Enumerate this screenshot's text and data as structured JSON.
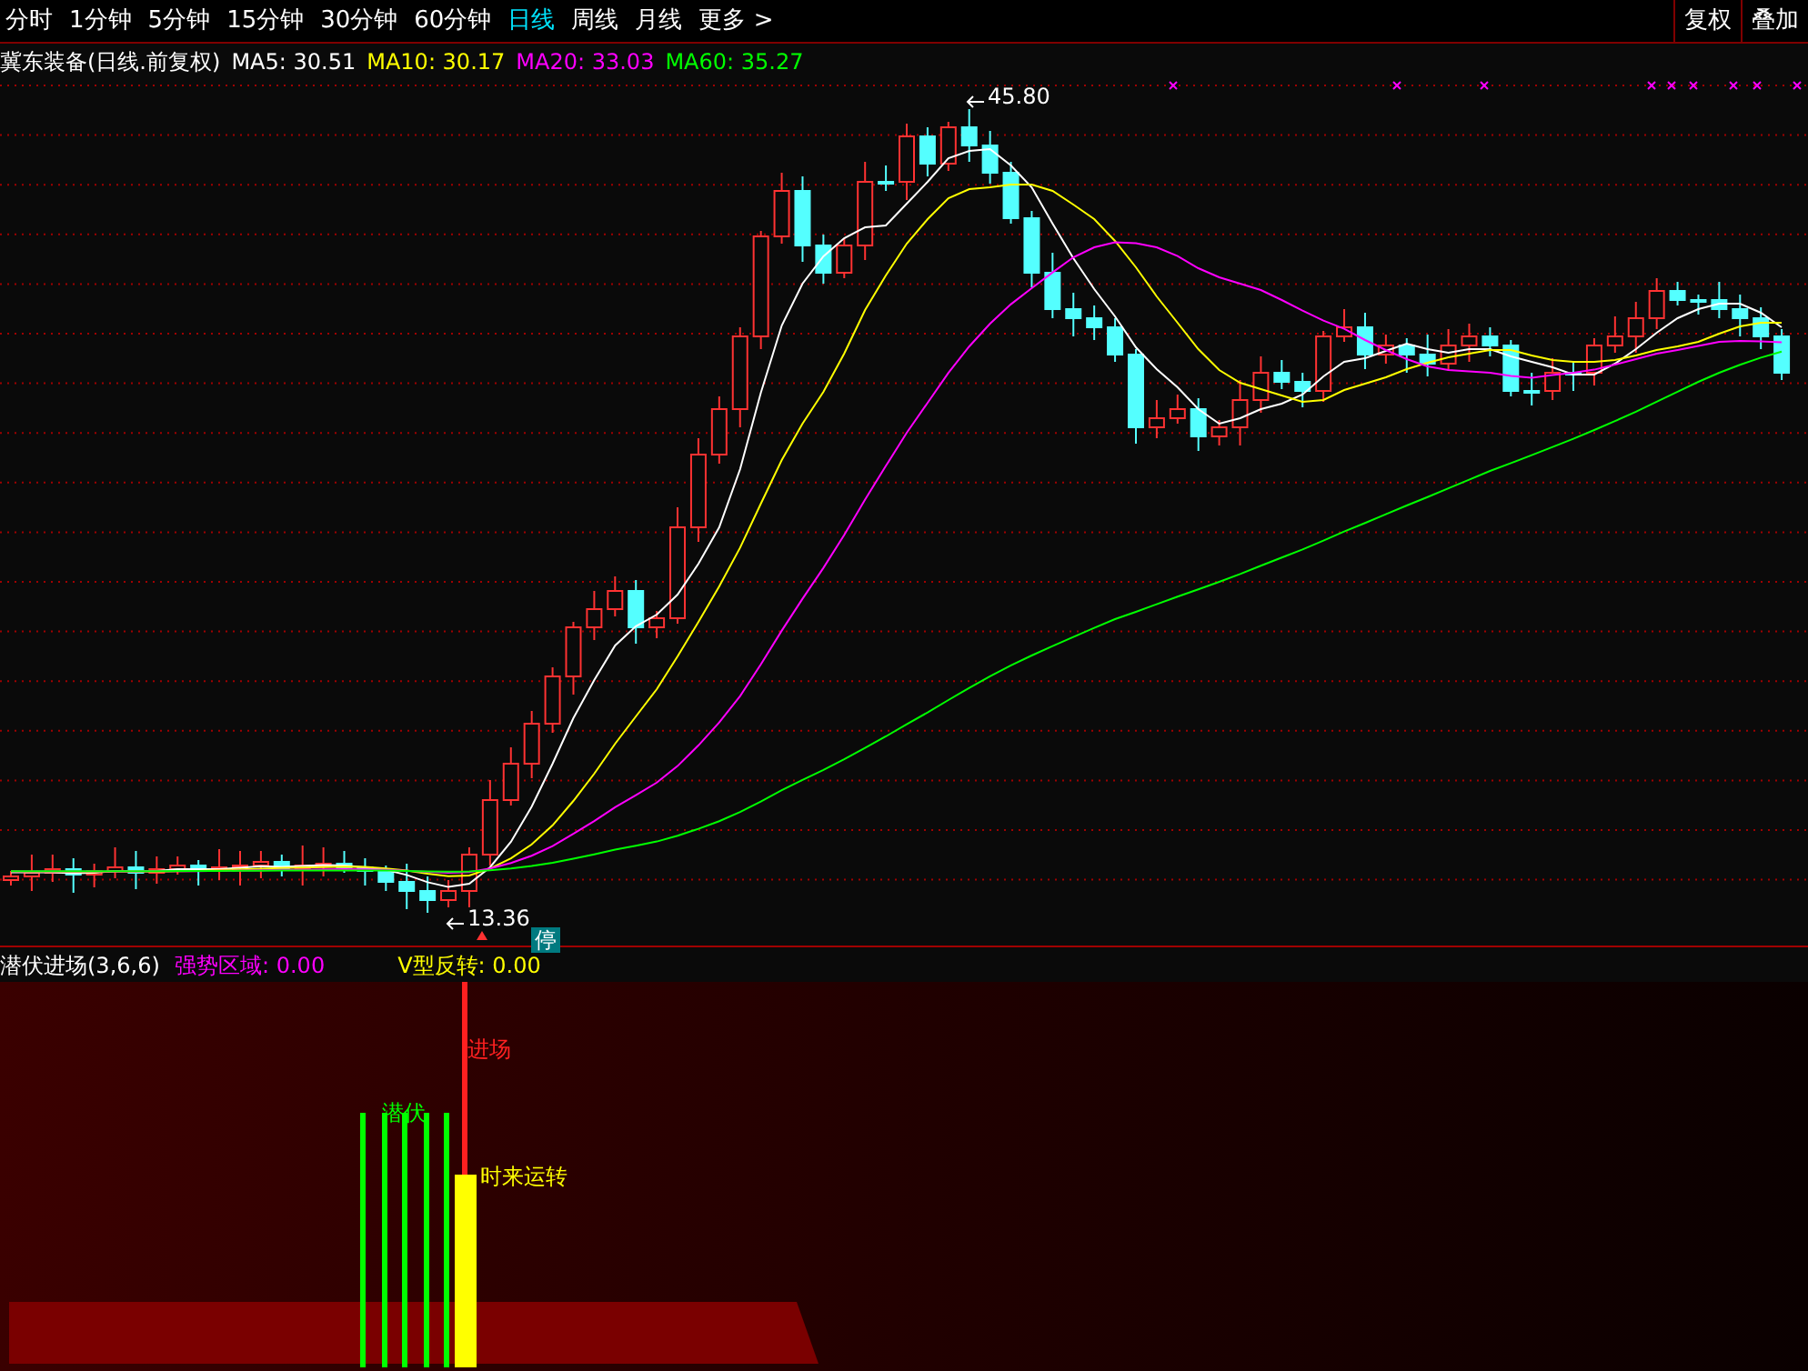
{
  "toolbar": {
    "periods": [
      {
        "label": "分时",
        "selected": false
      },
      {
        "label": "1分钟",
        "selected": false
      },
      {
        "label": "5分钟",
        "selected": false
      },
      {
        "label": "15分钟",
        "selected": false
      },
      {
        "label": "30分钟",
        "selected": false
      },
      {
        "label": "60分钟",
        "selected": false
      },
      {
        "label": "日线",
        "selected": true
      },
      {
        "label": "周线",
        "selected": false
      },
      {
        "label": "月线",
        "selected": false
      },
      {
        "label": "更多 >",
        "selected": false
      }
    ],
    "buttons": [
      "复权",
      "叠加"
    ]
  },
  "legend": {
    "title": "冀东装备(日线.前复权)",
    "items": [
      {
        "label": "MA5: 30.51",
        "color": "#ffffff"
      },
      {
        "label": "MA10: 30.17",
        "color": "#ffff00"
      },
      {
        "label": "MA20: 33.03",
        "color": "#ff00ff"
      },
      {
        "label": "MA60: 35.27",
        "color": "#00ff00"
      }
    ]
  },
  "price_chart": {
    "high_label": "45.80",
    "low_label": "13.36",
    "badge": "停"
  },
  "indicator": {
    "title": "潜伏进场(3,6,6)",
    "readouts": [
      {
        "label": "强势区域: 0.00",
        "kind": "strength"
      },
      {
        "label": "V型反转: 0.00",
        "kind": "reversal"
      }
    ],
    "signals": [
      {
        "label": "进场",
        "color": "#ff2020"
      },
      {
        "label": "潜伏",
        "color": "#00ff00"
      },
      {
        "label": "时来运转",
        "color": "#ffff00"
      }
    ]
  }
}
